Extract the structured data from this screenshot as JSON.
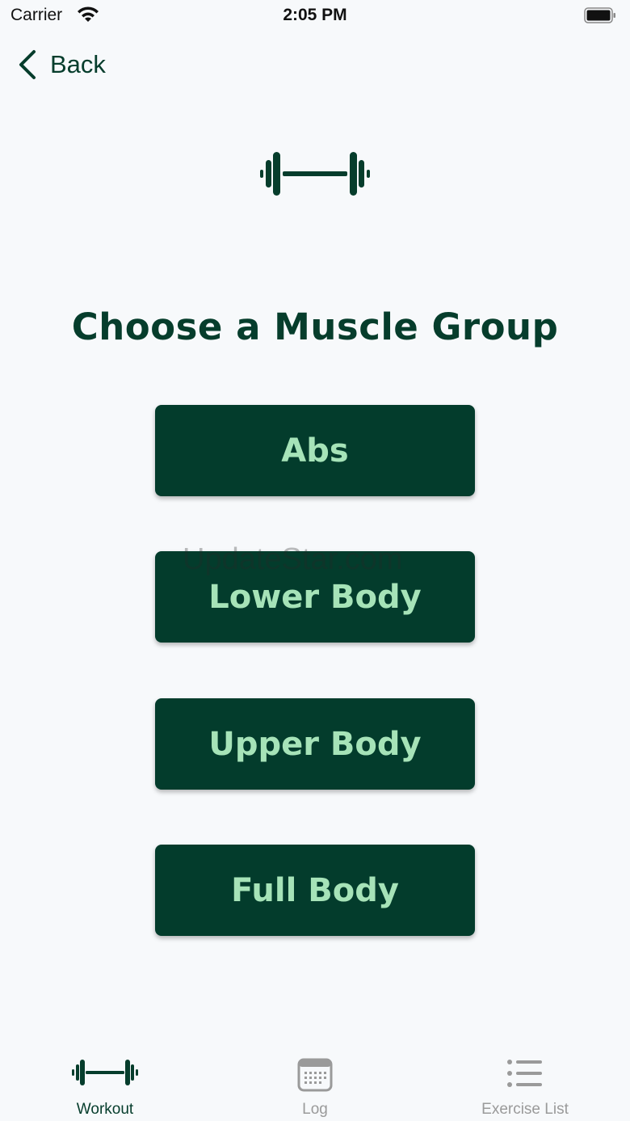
{
  "status_bar": {
    "carrier": "Carrier",
    "time": "2:05 PM"
  },
  "nav": {
    "back_label": "Back"
  },
  "title": "Choose a Muscle Group",
  "groups": [
    {
      "label": "Abs"
    },
    {
      "label": "Lower Body"
    },
    {
      "label": "Upper Body"
    },
    {
      "label": "Full Body"
    }
  ],
  "watermark": "UpdateStar.com",
  "tabs": [
    {
      "label": "Workout",
      "icon": "dumbbell-icon",
      "active": true
    },
    {
      "label": "Log",
      "icon": "calendar-icon",
      "active": false
    },
    {
      "label": "Exercise List",
      "icon": "list-icon",
      "active": false
    }
  ],
  "colors": {
    "primary": "#063d2c",
    "button_bg": "#033c2c",
    "button_text": "#a6e3b8",
    "background": "#f7f9fb",
    "inactive_tab": "#9a9a9a"
  }
}
